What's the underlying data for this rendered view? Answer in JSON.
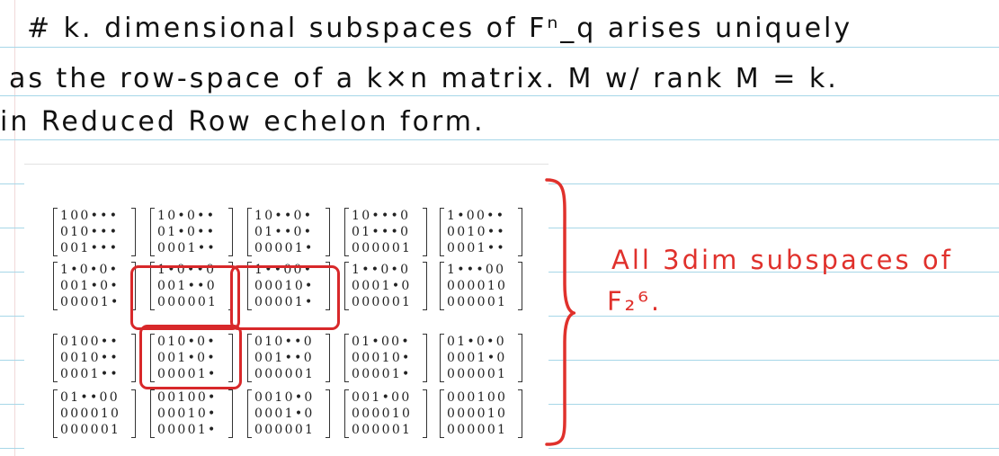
{
  "notes": {
    "line1": "# k. dimensional subspaces of Fⁿ_q arises uniquely",
    "line2": "as the row-space of a  k×n  matrix. M w/ rank M = k.",
    "line3": "in Reduced  Row echelon form."
  },
  "annotation": {
    "line1": "All  3dim subspaces of",
    "line2": "F₂⁶."
  },
  "colors": {
    "ink": "#111111",
    "red_pen": "#e0312c",
    "ruled_line": "#a7d7e8"
  },
  "matrices": [
    [
      "100•••",
      "010•••",
      "001•••"
    ],
    [
      "10•0••",
      "01•0••",
      "0001••"
    ],
    [
      "10••0•",
      "01••0•",
      "00001•"
    ],
    [
      "10•••0",
      "01•••0",
      "000001"
    ],
    [
      "1•00••",
      "0010••",
      "0001••"
    ],
    [
      "1•0•0•",
      "001•0•",
      "00001•"
    ],
    [
      "1•0••0",
      "001••0",
      "000001"
    ],
    [
      "1••00•",
      "00010•",
      "00001•"
    ],
    [
      "1••0•0",
      "0001•0",
      "000001"
    ],
    [
      "1•••00",
      "000010",
      "000001"
    ],
    [
      "0100••",
      "0010••",
      "0001••"
    ],
    [
      "010•0•",
      "001•0•",
      "00001•"
    ],
    [
      "010••0",
      "001••0",
      "000001"
    ],
    [
      "01•00•",
      "00010•",
      "00001•"
    ],
    [
      "01•0•0",
      "0001•0",
      "000001"
    ],
    [
      "01••00",
      "000010",
      "000001"
    ],
    [
      "00100•",
      "00010•",
      "00001•"
    ],
    [
      "0010•0",
      "0001•0",
      "000001"
    ],
    [
      "001•00",
      "000010",
      "000001"
    ],
    [
      "000100",
      "000010",
      "000001"
    ]
  ]
}
